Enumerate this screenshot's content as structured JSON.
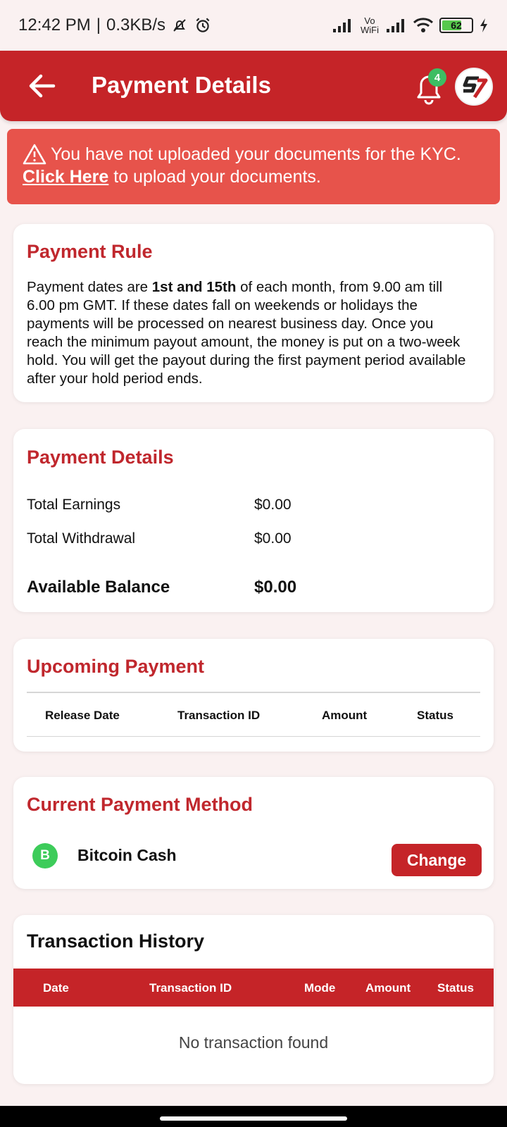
{
  "status_bar": {
    "time": "12:42 PM",
    "speed": "0.3KB/s",
    "vowifi": "Vo WiFi",
    "battery": "62",
    "icons": [
      "mute-icon",
      "alarm-icon",
      "signal-icon",
      "wifi-icon",
      "battery-icon",
      "charging-icon"
    ]
  },
  "app_bar": {
    "title": "Payment Details",
    "notification_count": "4",
    "avatar_text": "S7",
    "colors": {
      "primary": "#c52428",
      "badge": "#3dbd63"
    }
  },
  "kyc_banner": {
    "message": "You have not uploaded your documents for the KYC.",
    "link_text": "Click Here",
    "link_suffix": " to upload your documents."
  },
  "payment_rule": {
    "title": "Payment Rule",
    "text_before": "Payment dates are ",
    "text_bold": "1st and 15th ",
    "text_after": " of each month, from 9.00 am till 6.00 pm GMT. If these dates fall on weekends or holidays the payments will be processed on nearest business day. Once you reach the minimum payout amount, the money is put on a two-week hold. You will get the payout during the first payment period available after your hold period ends."
  },
  "payment_details": {
    "title": "Payment Details",
    "rows": [
      {
        "label": "Total Earnings",
        "value": "$0.00"
      },
      {
        "label": "Total Withdrawal",
        "value": "$0.00"
      },
      {
        "label": "Available Balance",
        "value": "$0.00"
      }
    ]
  },
  "upcoming_payment": {
    "title": "Upcoming Payment",
    "columns": [
      "Release Date",
      "Transaction ID",
      "Amount",
      "Status"
    ]
  },
  "payment_method": {
    "title": "Current Payment Method",
    "coin_symbol": "B",
    "name": "Bitcoin Cash",
    "change_label": "Change"
  },
  "transaction_history": {
    "title": "Transaction History",
    "columns": [
      "Date",
      "Transaction ID",
      "Mode",
      "Amount",
      "Status"
    ],
    "empty_message": "No transaction found"
  }
}
